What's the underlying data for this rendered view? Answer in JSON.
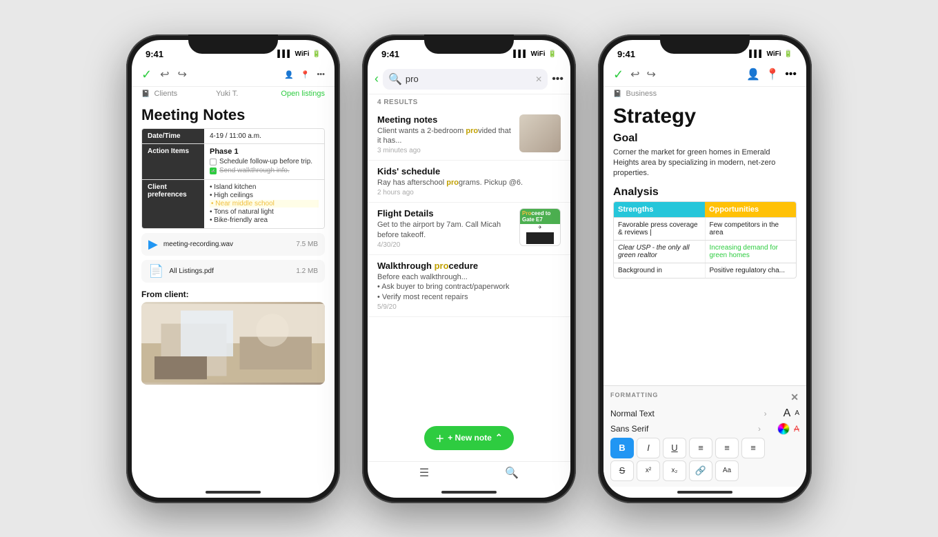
{
  "phone1": {
    "status_time": "9:41",
    "signal": "▌▌▌",
    "wifi": "WiFi",
    "battery": "■",
    "breadcrumb": "Clients",
    "user": "Yuki T.",
    "open_listings": "Open listings",
    "note_title": "Meeting Notes",
    "table": {
      "row1_header": "Date/Time",
      "row1_value": "4-19 / 11:00 a.m.",
      "row2_header": "Action Items",
      "phase_label": "Phase 1",
      "checkbox1": "Schedule follow-up before trip.",
      "checkbox2": "Send walkthrough info.",
      "row3_header": "Client preferences",
      "pref1": "Island kitchen",
      "pref2": "High ceilings",
      "pref3": "Near middle school",
      "pref4": "Tons of natural light",
      "pref5": "Bike-friendly area"
    },
    "attachment1_name": "meeting-recording.wav",
    "attachment1_size": "7.5 MB",
    "attachment2_name": "All Listings.pdf",
    "attachment2_size": "1.2 MB",
    "from_client_label": "From client:"
  },
  "phone2": {
    "status_time": "9:41",
    "search_query": "pro",
    "results_count": "4 RESULTS",
    "results": [
      {
        "title": "Meeting notes",
        "excerpt_before": "Client wants a 2-bedroom ",
        "excerpt_highlight": "pro",
        "excerpt_after": "vided that it has...",
        "time": "3 minutes ago",
        "has_thumb": true
      },
      {
        "title": "Kids' schedule",
        "excerpt_before": "Ray has afterschool ",
        "excerpt_highlight": "pro",
        "excerpt_after": "grams. Pickup @6.",
        "time": "2 hours ago",
        "has_thumb": false
      },
      {
        "title": "Flight Details",
        "excerpt_before": "Get to the airport by 7am. Call Micah before takeoff.",
        "excerpt_highlight": "",
        "excerpt_after": "",
        "time": "4/30/20",
        "has_thumb": true,
        "is_boarding": true
      },
      {
        "title": "Walkthrough pro",
        "title_before": "Walkthrough ",
        "title_highlight": "pro",
        "title_after": "cedure",
        "excerpt_before": "Before each walkthrough...",
        "bullet1": "Ask buyer to bring contract/paperwork",
        "bullet2": "Verify most recent repairs",
        "time": "5/9/20",
        "has_thumb": false,
        "is_walkthrough": true
      }
    ],
    "new_note_label": "+ New note",
    "nav_menu": "☰",
    "nav_search": "🔍"
  },
  "phone3": {
    "status_time": "9:41",
    "breadcrumb": "Business",
    "note_title": "Strategy",
    "goal_head": "Goal",
    "goal_text": "Corner the market for green homes in Emerald Heights area by specializing in modern, net-zero properties.",
    "analysis_head": "Analysis",
    "swot": {
      "header1": "Strengths",
      "header2": "Opportunities",
      "row1_col1": "Favorable press coverage & reviews |",
      "row1_col2": "Few competitors in the area",
      "row2_col1_plain": "Clear USP - ",
      "row2_col1_italic": "the only all green realtor",
      "row2_col2": "Increasing demand for green homes",
      "row3_col1": "Background in",
      "row3_col2": "Positive regulatory cha..."
    },
    "formatting": {
      "panel_title": "FORMATTING",
      "close_label": "✕",
      "style_label": "Normal Text",
      "font_label": "Sans Serif",
      "btn_bold": "B",
      "btn_italic": "I",
      "btn_underline": "U",
      "btn_align_left": "≡",
      "btn_align_center": "≡",
      "btn_align_right": "≡",
      "btn_strike": "S",
      "btn_super": "x²",
      "btn_sub": "x₂",
      "btn_link": "🔗",
      "btn_clear": "Aa"
    }
  }
}
